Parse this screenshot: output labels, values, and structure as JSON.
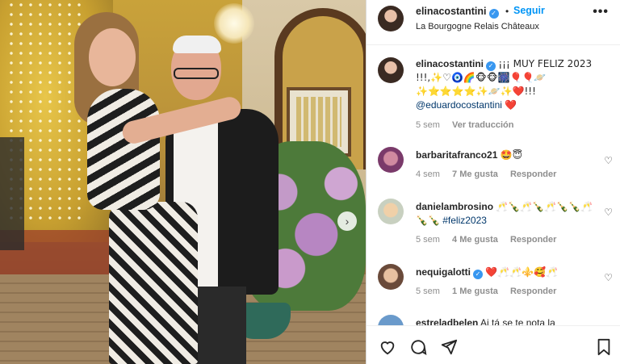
{
  "post": {
    "author": "elinacostantini",
    "follow_label": "Seguir",
    "separator": "•",
    "location": "La Bourgogne Relais Châteaux",
    "more_label": "•••"
  },
  "caption": {
    "author": "elinacostantini",
    "text": "¡¡¡ MUY FELIZ 2023 !!!,✨♡🧿🌈🐵🐵🎆🎈🎈🪐✨⭐⭐⭐⭐✨🪐✨❤️!!!",
    "mention": "@eduardocostantini",
    "trailing": "❤️",
    "time": "5 sem",
    "translate_label": "Ver traducción"
  },
  "comments": [
    {
      "author": "barbaritafranco21",
      "text": "🤩😇",
      "time": "4 sem",
      "likes": "7 Me gusta",
      "reply_label": "Responder"
    },
    {
      "author": "danielambrosino",
      "text": "🥂🍾🥂🍾🥂🍾🍾🥂🍾🍾",
      "hashtag": "#feliz2023",
      "time": "5 sem",
      "likes": "4 Me gusta",
      "reply_label": "Responder"
    },
    {
      "author": "nequigalotti",
      "text": "❤️🥂🥂⚜️🥰🥂",
      "time": "5 sem",
      "likes": "1 Me gusta",
      "reply_label": "Responder"
    },
    {
      "author": "estreladbelen",
      "text": "Ai tá se te nota la"
    }
  ],
  "icons": {
    "heart": "heart-icon",
    "comment": "comment-icon",
    "share": "send-icon",
    "save": "bookmark-icon",
    "next": "chevron-right-icon",
    "verified": "verified-badge-icon"
  },
  "colors": {
    "accent": "#0095f6",
    "verified": "#3897f0",
    "muted": "#8e8e8e",
    "heart_red": "#ed4956"
  }
}
